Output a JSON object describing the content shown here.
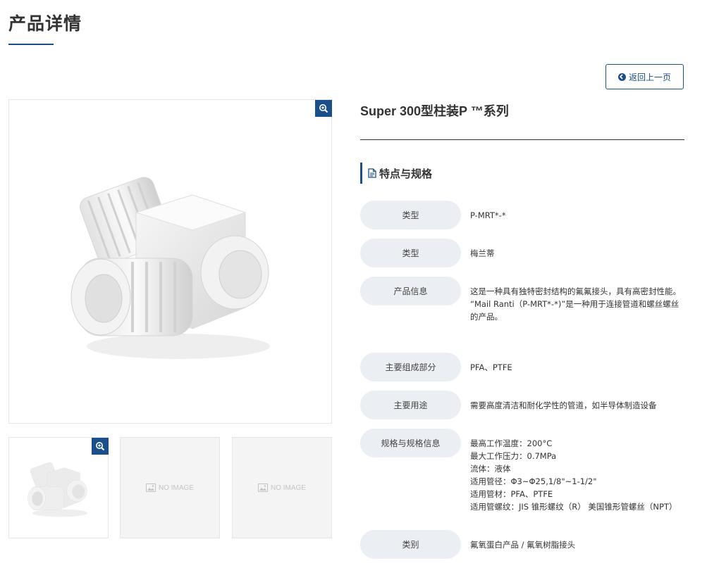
{
  "page": {
    "title": "产品详情"
  },
  "back_button": {
    "label": "返回上一页"
  },
  "gallery": {
    "main_image_alt": "Super 300型柱装P ™系列",
    "thumbnails": [
      {
        "type": "image"
      },
      {
        "type": "placeholder",
        "label": "NO IMAGE"
      },
      {
        "type": "placeholder",
        "label": "NO IMAGE"
      }
    ]
  },
  "product": {
    "title": "Super 300型柱装P ™系列",
    "section_title": "特点与规格",
    "specs": [
      {
        "label": "类型",
        "value": "P-MRT*-*"
      },
      {
        "label": "类型",
        "value": "梅兰蒂"
      },
      {
        "label": "产品信息",
        "lines": [
          "这是一种具有独特密封结构的氟氟接头，具有高密封性能。",
          "“Mail Ranti（P-MRT*-*)”是一种用于连接管道和螺丝螺丝的产品。"
        ]
      },
      {
        "label": "主要组成部分",
        "value": "PFA、PTFE"
      },
      {
        "label": "主要用途",
        "value": "需要高度清洁和耐化学性的管道，如半导体制造设备"
      },
      {
        "label": "规格与规格信息",
        "lines": [
          "最高工作温度：200°C",
          "最大工作压力：0.7MPa",
          "流体：液体",
          "适用管径：Φ3~Φ25,1/8\"~1-1/2\"",
          "适用管材：PFA、PTFE",
          "适用管螺纹：JIS 锥形螺纹（R） 美国锥形管螺丝（NPT）"
        ]
      },
      {
        "label": "类别",
        "value": "氟氧蛋白产品 / 氟氧树脂接头"
      }
    ]
  },
  "colors": {
    "accent": "#1b4f8a",
    "pill_bg": "#ebeef2",
    "placeholder_bg": "#f4f4f4"
  },
  "icons": {
    "zoom": "zoom-in-icon",
    "back": "circle-arrow-left-icon",
    "doc": "document-icon",
    "noimage": "image-icon"
  }
}
